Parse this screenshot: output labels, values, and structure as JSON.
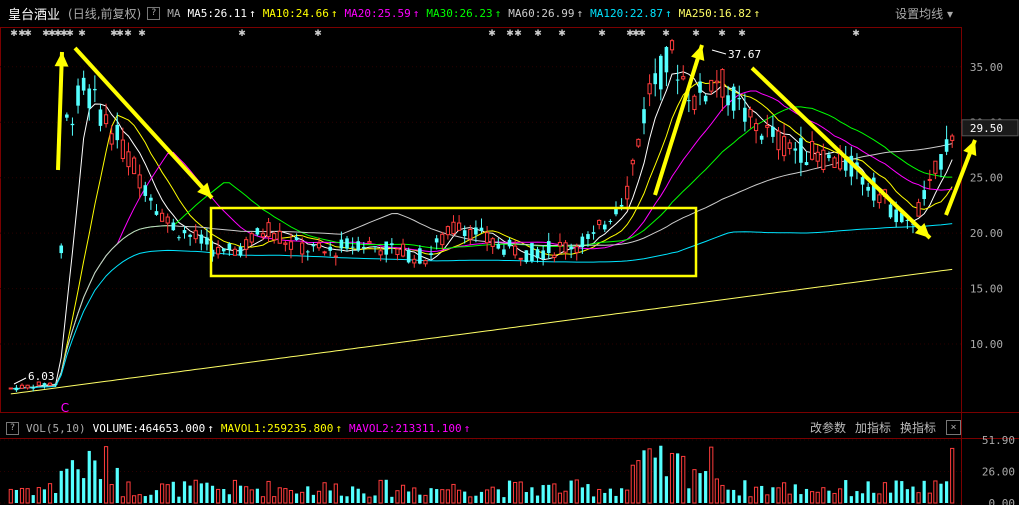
{
  "header": {
    "stock_name": "皇台酒业",
    "period_label": "(日线,前复权)",
    "ma_label": "MA",
    "ma_items": [
      {
        "label": "MA5:26.11",
        "color": "#ffffff"
      },
      {
        "label": "MA10:24.66",
        "color": "#ffff00"
      },
      {
        "label": "MA20:25.59",
        "color": "#ff00ff"
      },
      {
        "label": "MA30:26.23",
        "color": "#00ff00"
      },
      {
        "label": "MA60:26.99",
        "color": "#cccccc"
      },
      {
        "label": "MA120:22.87",
        "color": "#00e5ff"
      },
      {
        "label": "MA250:16.82",
        "color": "#ffff66"
      }
    ],
    "arrow_glyph": "↑",
    "settings_label": "设置均线"
  },
  "volume_header": {
    "indicator": "VOL(5,10)",
    "items": [
      {
        "label": "VOLUME:464653.000",
        "color": "#ffffff"
      },
      {
        "label": "MAVOL1:259235.800",
        "color": "#ffff00"
      },
      {
        "label": "MAVOL2:213311.100",
        "color": "#ff00ff"
      }
    ],
    "buttons": [
      "改参数",
      "加指标",
      "换指标"
    ],
    "close_glyph": "×"
  },
  "price_axis": {
    "ticks": [
      "35.00",
      "30.00",
      "25.00",
      "20.00",
      "15.00",
      "10.00"
    ],
    "current": "29.50"
  },
  "volume_axis": {
    "ticks": [
      "51.90",
      "26.00",
      "0.00"
    ]
  },
  "chart_data": {
    "type": "candlestick",
    "price_ylim": [
      4.5,
      38.5
    ],
    "high_label": "37.67",
    "low_label": "6.03",
    "event_marker": "C",
    "candles_sample": [
      {
        "o": 6.0,
        "c": 6.3,
        "h": 6.4,
        "l": 5.8
      },
      {
        "o": 6.6,
        "c": 7.3,
        "h": 7.5,
        "l": 6.5
      },
      {
        "o": 6.5,
        "c": 6.2,
        "h": 6.7,
        "l": 6.1
      },
      {
        "o": 10.0,
        "c": 30.5,
        "h": 31.0,
        "l": 9.5
      },
      {
        "o": 33.0,
        "c": 32.0,
        "h": 34.5,
        "l": 31.0
      },
      {
        "o": 31.0,
        "c": 27.0,
        "h": 31.5,
        "l": 26.5
      },
      {
        "o": 26.0,
        "c": 22.5,
        "h": 27.0,
        "l": 22.0
      },
      {
        "o": 22.0,
        "c": 20.0,
        "h": 22.5,
        "l": 19.5
      },
      {
        "o": 19.0,
        "c": 17.0,
        "h": 19.5,
        "l": 16.8
      },
      {
        "o": 18.0,
        "c": 18.8,
        "h": 19.5,
        "l": 17.5
      },
      {
        "o": 19.0,
        "c": 21.5,
        "h": 22.5,
        "l": 18.8
      },
      {
        "o": 20.0,
        "c": 18.0,
        "h": 20.5,
        "l": 17.5
      },
      {
        "o": 18.5,
        "c": 19.5,
        "h": 20.0,
        "l": 18.0
      },
      {
        "o": 19.0,
        "c": 22.0,
        "h": 22.5,
        "l": 18.8
      },
      {
        "o": 20.5,
        "c": 18.2,
        "h": 21.0,
        "l": 18.0
      },
      {
        "o": 18.5,
        "c": 19.5,
        "h": 20.0,
        "l": 18.2
      },
      {
        "o": 19.5,
        "c": 25.0,
        "h": 26.0,
        "l": 19.0
      },
      {
        "o": 27.0,
        "c": 37.0,
        "h": 37.67,
        "l": 26.5
      },
      {
        "o": 36.0,
        "c": 32.0,
        "h": 37.0,
        "l": 31.0
      },
      {
        "o": 32.0,
        "c": 34.0,
        "h": 35.5,
        "l": 31.5
      },
      {
        "o": 31.0,
        "c": 29.0,
        "h": 32.0,
        "l": 28.5
      },
      {
        "o": 28.0,
        "c": 26.0,
        "h": 29.5,
        "l": 25.5
      },
      {
        "o": 25.0,
        "c": 23.0,
        "h": 26.0,
        "l": 22.5
      },
      {
        "o": 22.0,
        "c": 20.5,
        "h": 23.0,
        "l": 20.0
      },
      {
        "o": 22.5,
        "c": 24.0,
        "h": 25.0,
        "l": 22.0
      },
      {
        "o": 26.0,
        "c": 29.5,
        "h": 30.0,
        "l": 25.5
      }
    ],
    "volume_ylim": [
      0,
      51.9
    ],
    "volume_units": "万"
  }
}
